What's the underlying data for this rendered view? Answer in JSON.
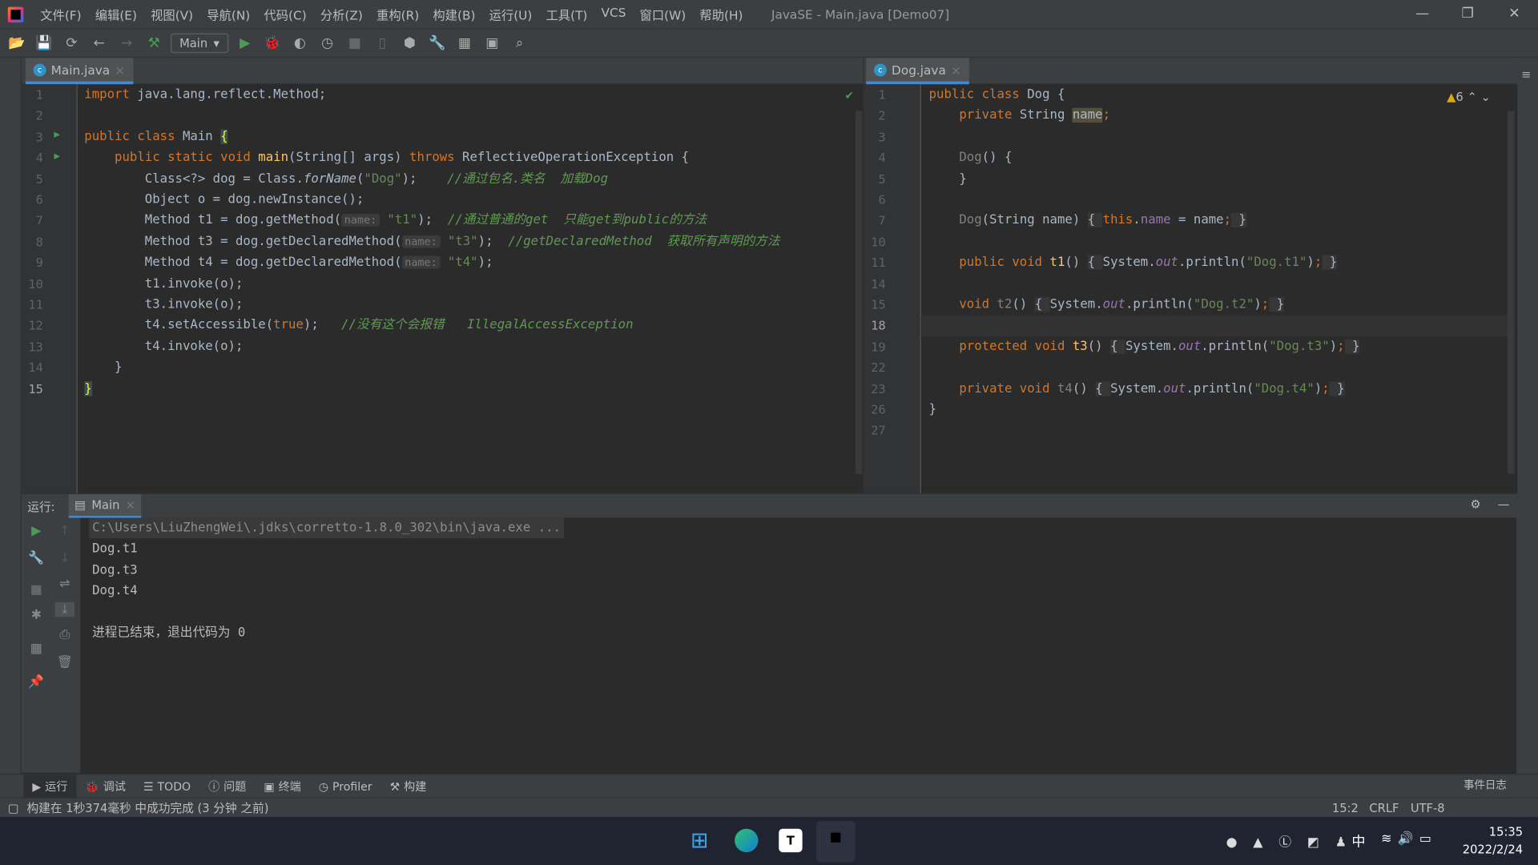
{
  "menubar": {
    "items": [
      "文件(F)",
      "编辑(E)",
      "视图(V)",
      "导航(N)",
      "代码(C)",
      "分析(Z)",
      "重构(R)",
      "构建(B)",
      "运行(U)",
      "工具(T)",
      "VCS",
      "窗口(W)",
      "帮助(H)"
    ],
    "title": "JavaSE - Main.java [Demo07]"
  },
  "toolbar": {
    "run_config": "Main"
  },
  "left_editor": {
    "tab": "Main.java",
    "line_numbers": [
      "1",
      "2",
      "3",
      "4",
      "5",
      "6",
      "7",
      "8",
      "9",
      "10",
      "11",
      "12",
      "13",
      "14",
      "15"
    ],
    "lines": [
      [
        [
          "kw",
          "import "
        ],
        [
          "pln",
          "java.lang.reflect.Method;"
        ]
      ],
      [],
      [
        [
          "kw",
          "public class "
        ],
        [
          "pln",
          "Main "
        ],
        [
          "brace",
          "{"
        ]
      ],
      [
        [
          "pln",
          "    "
        ],
        [
          "kw",
          "public static void "
        ],
        [
          "fn",
          "main"
        ],
        [
          "pln",
          "(String[] args) "
        ],
        [
          "kw",
          "throws "
        ],
        [
          "pln",
          "ReflectiveOperationException {"
        ]
      ],
      [
        [
          "pln",
          "        Class<?> dog = Class."
        ],
        [
          "it",
          "forName"
        ],
        [
          "pln",
          "("
        ],
        [
          "str",
          "\"Dog\""
        ],
        [
          "pln",
          ");    "
        ],
        [
          "cm",
          "//通过包名.类名  加载Dog"
        ]
      ],
      [
        [
          "pln",
          "        Object o = dog.newInstance();"
        ]
      ],
      [
        [
          "pln",
          "        Method t1 = dog.getMethod("
        ],
        [
          "hint",
          "name:"
        ],
        [
          "str",
          " \"t1\""
        ],
        [
          "pln",
          ");  "
        ],
        [
          "cm",
          "//通过普通的get  只能get到public的方法"
        ]
      ],
      [
        [
          "pln",
          "        Method t3 = dog.getDeclaredMethod("
        ],
        [
          "hint",
          "name:"
        ],
        [
          "str",
          " \"t3\""
        ],
        [
          "pln",
          ");  "
        ],
        [
          "cm",
          "//getDeclaredMethod  获取所有声明的方法"
        ]
      ],
      [
        [
          "pln",
          "        Method t4 = dog.getDeclaredMethod("
        ],
        [
          "hint",
          "name:"
        ],
        [
          "str",
          " \"t4\""
        ],
        [
          "pln",
          ");"
        ]
      ],
      [
        [
          "pln",
          "        t1.invoke(o);"
        ]
      ],
      [
        [
          "pln",
          "        t3.invoke(o);"
        ]
      ],
      [
        [
          "pln",
          "        t4.setAccessible("
        ],
        [
          "kw",
          "true"
        ],
        [
          "pln",
          ");   "
        ],
        [
          "cm",
          "//没有这个会报错   IllegalAccessException"
        ]
      ],
      [
        [
          "pln",
          "        t4.invoke(o);"
        ]
      ],
      [
        [
          "pln",
          "    }"
        ]
      ],
      [
        [
          "brace",
          "}"
        ]
      ]
    ]
  },
  "right_editor": {
    "tab": "Dog.java",
    "warnings": "6",
    "line_numbers": [
      "1",
      "2",
      "3",
      "4",
      "5",
      "6",
      "7",
      "10",
      "11",
      "14",
      "15",
      "18",
      "19",
      "22",
      "23",
      "26",
      "27"
    ],
    "lines": [
      [
        [
          "kw",
          "public class "
        ],
        [
          "pln",
          "Dog {"
        ]
      ],
      [
        [
          "pln",
          "    "
        ],
        [
          "kw",
          "private "
        ],
        [
          "pln",
          "String "
        ],
        [
          "hl",
          "name"
        ],
        [
          "kw",
          ";"
        ]
      ],
      [],
      [
        [
          "pln",
          "    "
        ],
        [
          "dim",
          "Dog"
        ],
        [
          "pln",
          "() {"
        ]
      ],
      [
        [
          "pln",
          "    }"
        ]
      ],
      [],
      [
        [
          "pln",
          "    "
        ],
        [
          "dim",
          "Dog"
        ],
        [
          "pln",
          "(String name) "
        ],
        [
          "fold",
          "{ "
        ],
        [
          "kw",
          "this"
        ],
        [
          "pln",
          "."
        ],
        [
          "fld",
          "name"
        ],
        [
          "pln",
          " = name"
        ],
        [
          "kw",
          ";"
        ],
        [
          "fold",
          " }"
        ]
      ],
      [],
      [
        [
          "pln",
          "    "
        ],
        [
          "kw",
          "public void "
        ],
        [
          "fn",
          "t1"
        ],
        [
          "pln",
          "() "
        ],
        [
          "fold",
          "{ "
        ],
        [
          "pln",
          "System."
        ],
        [
          "fldi",
          "out"
        ],
        [
          "pln",
          ".println("
        ],
        [
          "str",
          "\"Dog.t1\""
        ],
        [
          "pln",
          ")"
        ],
        [
          "kw",
          ";"
        ],
        [
          "fold",
          " }"
        ]
      ],
      [],
      [
        [
          "pln",
          "    "
        ],
        [
          "kw",
          "void "
        ],
        [
          "dim",
          "t2"
        ],
        [
          "pln",
          "() "
        ],
        [
          "fold",
          "{ "
        ],
        [
          "pln",
          "System."
        ],
        [
          "fldi",
          "out"
        ],
        [
          "pln",
          ".println("
        ],
        [
          "str",
          "\"Dog.t2\""
        ],
        [
          "pln",
          ")"
        ],
        [
          "kw",
          ";"
        ],
        [
          "fold",
          " }"
        ]
      ],
      [],
      [
        [
          "pln",
          "    "
        ],
        [
          "kw",
          "protected void "
        ],
        [
          "fn",
          "t3"
        ],
        [
          "pln",
          "() "
        ],
        [
          "fold",
          "{ "
        ],
        [
          "pln",
          "System."
        ],
        [
          "fldi",
          "out"
        ],
        [
          "pln",
          ".println("
        ],
        [
          "str",
          "\"Dog.t3\""
        ],
        [
          "pln",
          ")"
        ],
        [
          "kw",
          ";"
        ],
        [
          "fold",
          " }"
        ]
      ],
      [],
      [
        [
          "pln",
          "    "
        ],
        [
          "kw",
          "private void "
        ],
        [
          "dim",
          "t4"
        ],
        [
          "pln",
          "() "
        ],
        [
          "fold",
          "{ "
        ],
        [
          "pln",
          "System."
        ],
        [
          "fldi",
          "out"
        ],
        [
          "pln",
          ".println("
        ],
        [
          "str",
          "\"Dog.t4\""
        ],
        [
          "pln",
          ")"
        ],
        [
          "kw",
          ";"
        ],
        [
          "fold",
          " }"
        ]
      ],
      [
        [
          "pln",
          "}"
        ]
      ],
      []
    ]
  },
  "run": {
    "label": "运行:",
    "tab": "Main",
    "output": [
      "C:\\Users\\LiuZhengWei\\.jdks\\corretto-1.8.0_302\\bin\\java.exe ...",
      "Dog.t1",
      "Dog.t3",
      "Dog.t4",
      "",
      "进程已结束，退出代码为 0"
    ]
  },
  "bottom_tabs": [
    "运行",
    "调试",
    "TODO",
    "问题",
    "终端",
    "Profiler",
    "构建"
  ],
  "status": {
    "message": "构建在 1秒374毫秒 中成功完成 (3 分钟 之前)",
    "position": "15:2",
    "line_sep": "CRLF",
    "encoding": "UTF-8",
    "event_log": "事件日志"
  },
  "taskbar": {
    "ime": "中",
    "time": "15:35",
    "date": "2022/2/24"
  }
}
